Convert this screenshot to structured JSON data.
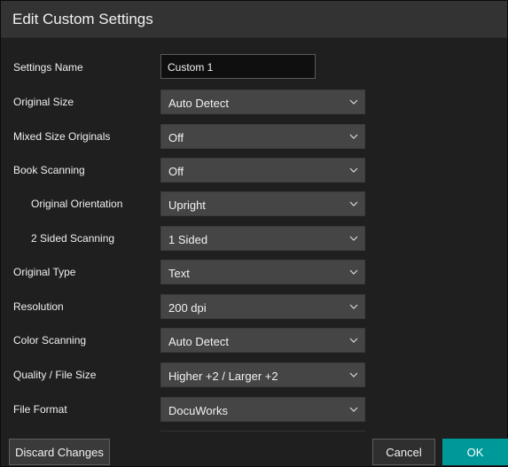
{
  "dialog": {
    "title": "Edit Custom Settings",
    "accent_color": "#009999"
  },
  "settings": {
    "name": {
      "label": "Settings Name",
      "value": "Custom 1"
    },
    "original_size": {
      "label": "Original Size",
      "value": "Auto Detect"
    },
    "mixed_size": {
      "label": "Mixed Size Originals",
      "value": "Off"
    },
    "book_scanning": {
      "label": "Book Scanning",
      "value": "Off"
    },
    "original_orientation": {
      "label": "Original Orientation",
      "value": "Upright"
    },
    "two_sided": {
      "label": "2 Sided Scanning",
      "value": "1 Sided"
    },
    "original_type": {
      "label": "Original Type",
      "value": "Text"
    },
    "resolution": {
      "label": "Resolution",
      "value": "200 dpi"
    },
    "color_scanning": {
      "label": "Color Scanning",
      "value": "Auto Detect"
    },
    "quality": {
      "label": "Quality / File Size",
      "value": "Higher +2 / Larger +2"
    },
    "file_format": {
      "label": "File Format",
      "value": "DocuWorks"
    }
  },
  "footer": {
    "discard_label": "Discard Changes",
    "cancel_label": "Cancel",
    "ok_label": "OK"
  },
  "icons": {
    "dropdown": "chevron-down-icon"
  }
}
